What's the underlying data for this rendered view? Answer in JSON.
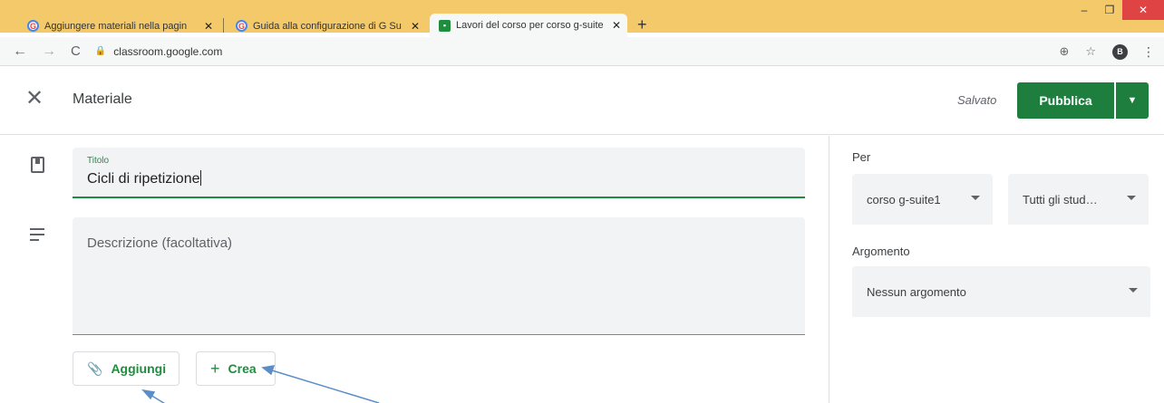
{
  "browser": {
    "tabs": [
      {
        "title": "Aggiungere materiali nella pagin",
        "icon": "google-icon"
      },
      {
        "title": "Guida alla configurazione di G Su",
        "icon": "google-icon"
      },
      {
        "title": "Lavori del corso per corso g-suite",
        "icon": "classroom-icon"
      }
    ],
    "new_tab": "+",
    "url": "classroom.google.com",
    "profile_initial": "B",
    "tab_strip_color": "#f3c96a"
  },
  "header": {
    "title": "Materiale",
    "status": "Salvato",
    "publish_label": "Pubblica",
    "accent": "#1e7e3e"
  },
  "form": {
    "title_label": "Titolo",
    "title_value": "Cicli di ripetizione",
    "description_placeholder": "Descrizione (facoltativa)",
    "add_label": "Aggiungi",
    "create_label": "Crea"
  },
  "sidebar": {
    "for_label": "Per",
    "class_value": "corso g-suite1",
    "students_value": "Tutti gli stud…",
    "topic_label": "Argomento",
    "topic_value": "Nessun argomento"
  }
}
